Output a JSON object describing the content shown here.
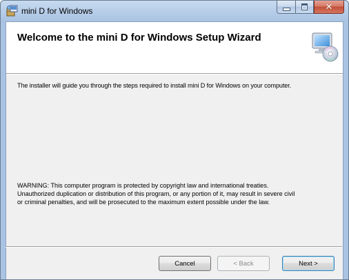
{
  "window": {
    "title": "mini D for Windows",
    "title_icon": "installer-package-icon",
    "controls": {
      "minimize_icon": "minimize-icon",
      "maximize_icon": "maximize-icon",
      "close_icon": "close-icon",
      "close_glyph": "✕"
    }
  },
  "banner": {
    "title": "Welcome to the mini D for Windows Setup Wizard",
    "icon": "computer-with-disc-icon"
  },
  "body": {
    "intro": "The installer will guide you through the steps required to install mini D for Windows on your computer.",
    "warning_lines": [
      "WARNING: This computer program is protected by copyright law and international treaties.",
      "Unauthorized duplication or distribution of this program, or any portion of it, may result in severe civil",
      "or criminal penalties, and will be prosecuted to the maximum extent possible under the law."
    ]
  },
  "buttons": {
    "cancel": "Cancel",
    "back": "< Back",
    "next": "Next >"
  },
  "colors": {
    "titlebar": "#b9cfe9",
    "client_background": "#f0f0f0",
    "banner_background": "#ffffff",
    "close_button": "#c24f38",
    "default_button_border": "#3c7fb1"
  }
}
